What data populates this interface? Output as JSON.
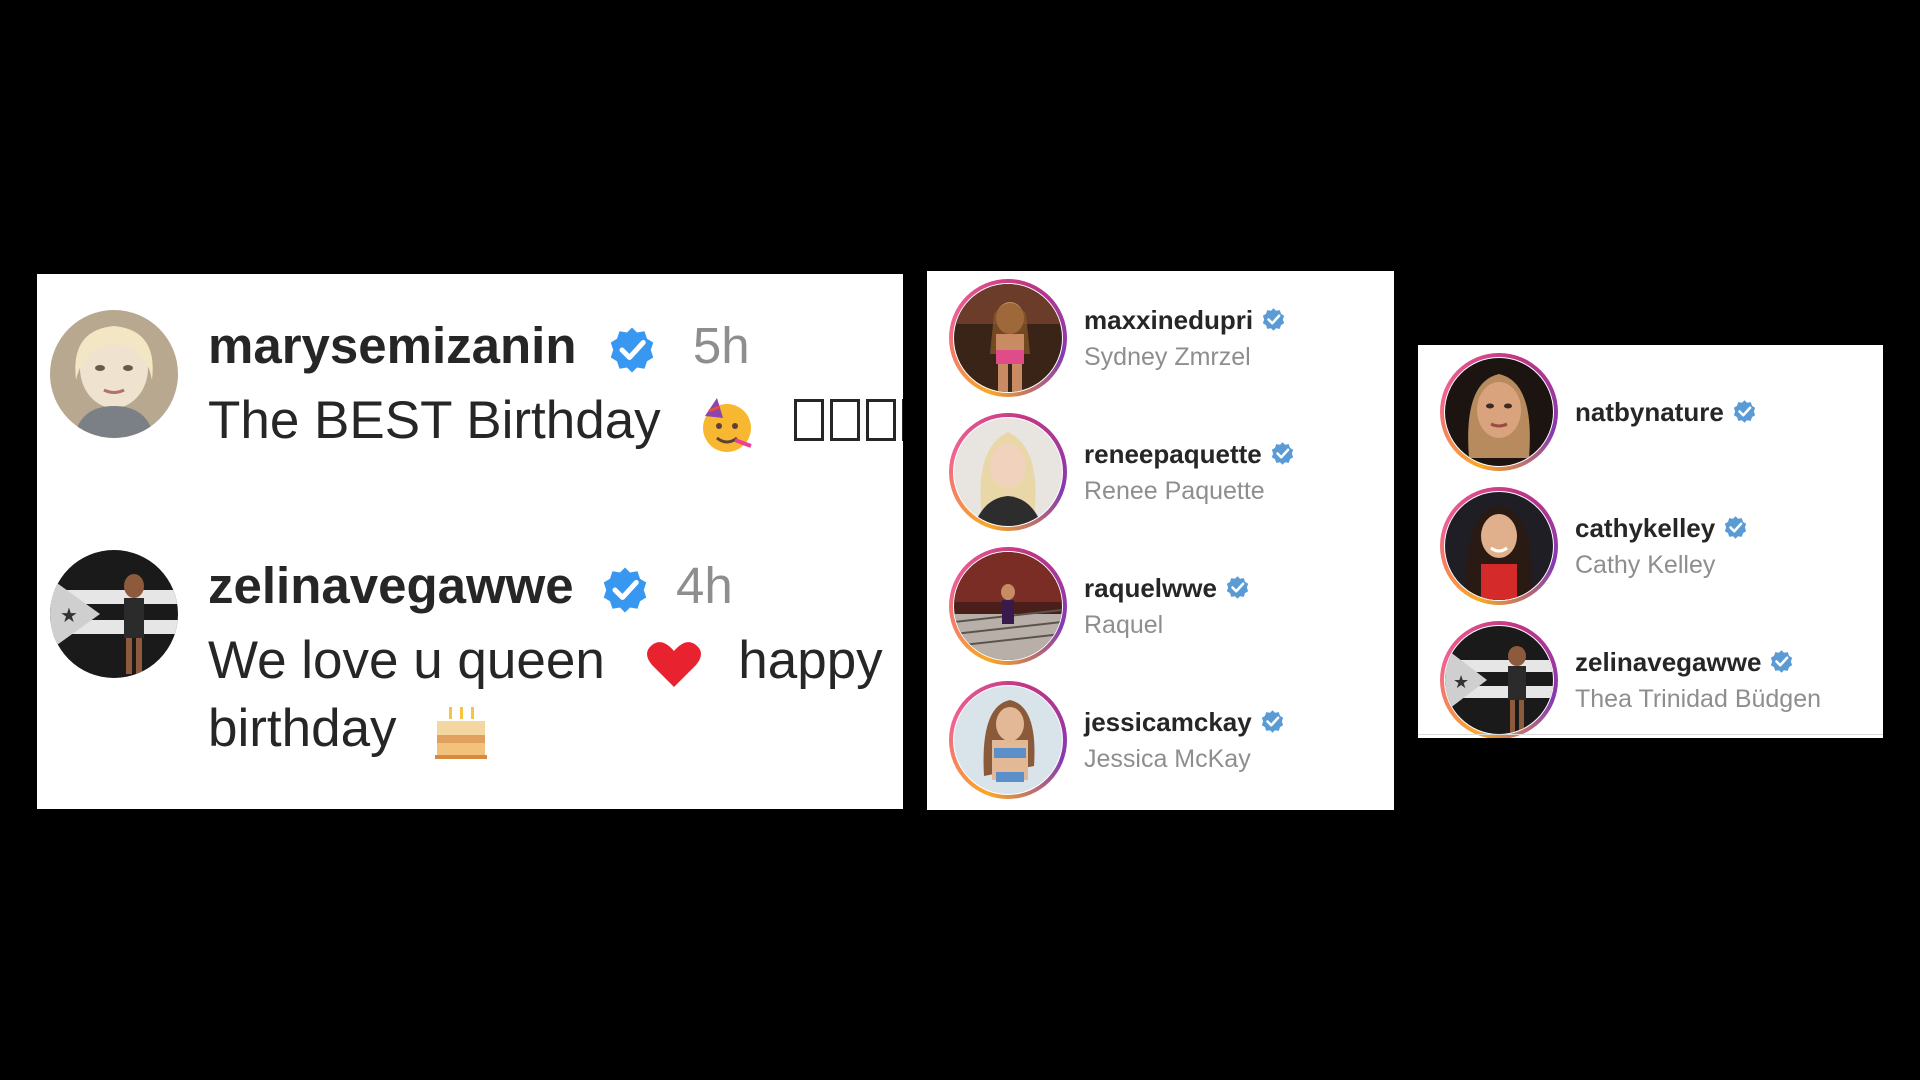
{
  "comments": [
    {
      "username": "marysemizanin",
      "time": "5h",
      "text": "The BEST Birthday",
      "emoji": "partying-face-icon",
      "avatar": "avatar-blonde"
    },
    {
      "username": "zelinavegawwe",
      "time": "4h",
      "text_line1": "We love u queen",
      "text_line1_after": "happy",
      "text_line2": "birthday",
      "emoji1": "red-heart-icon",
      "emoji2": "birthday-cake-icon",
      "avatar": "avatar-flag"
    }
  ],
  "list1": [
    {
      "handle": "maxxinedupri",
      "name": "Sydney Zmrzel"
    },
    {
      "handle": "reneepaquette",
      "name": "Renee Paquette"
    },
    {
      "handle": "raquelwwe",
      "name": "Raquel"
    },
    {
      "handle": "jessicamckay",
      "name": "Jessica McKay"
    }
  ],
  "list2": [
    {
      "handle": "natbynature",
      "name": ""
    },
    {
      "handle": "cathykelley",
      "name": "Cathy Kelley"
    },
    {
      "handle": "zelinavegawwe",
      "name": "Thea Trinidad Büdgen"
    }
  ],
  "colors": {
    "verified": "#3897f0",
    "verified_list": "#5b9bd5",
    "text": "#262626",
    "secondary": "#8e8e8e",
    "heart": "#e8232f"
  }
}
